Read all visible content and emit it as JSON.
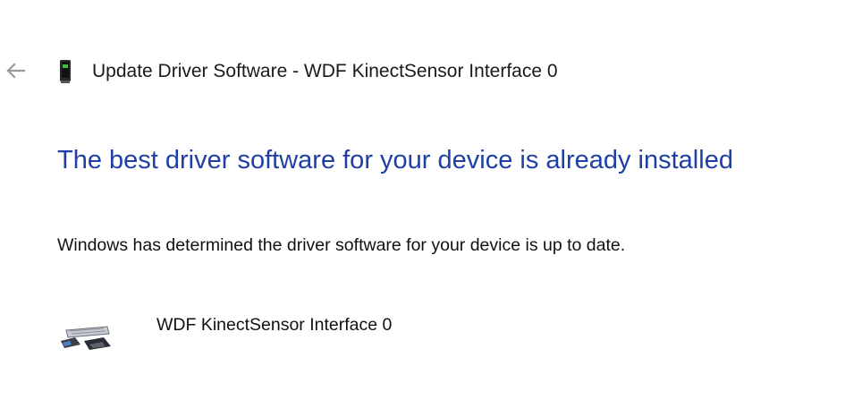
{
  "window": {
    "title": "Update Driver Software - WDF KinectSensor Interface 0",
    "back_icon": "back-arrow-icon",
    "device_icon": "sensor-device-icon"
  },
  "content": {
    "heading": "The best driver software for your device is already installed",
    "message": "Windows has determined the driver software for your device is up to date.",
    "device_name": "WDF KinectSensor Interface 0",
    "device_icon": "kinect-sensor-icon"
  },
  "colors": {
    "heading": "#1f3fa6",
    "back_arrow": "#9a9a9a"
  }
}
